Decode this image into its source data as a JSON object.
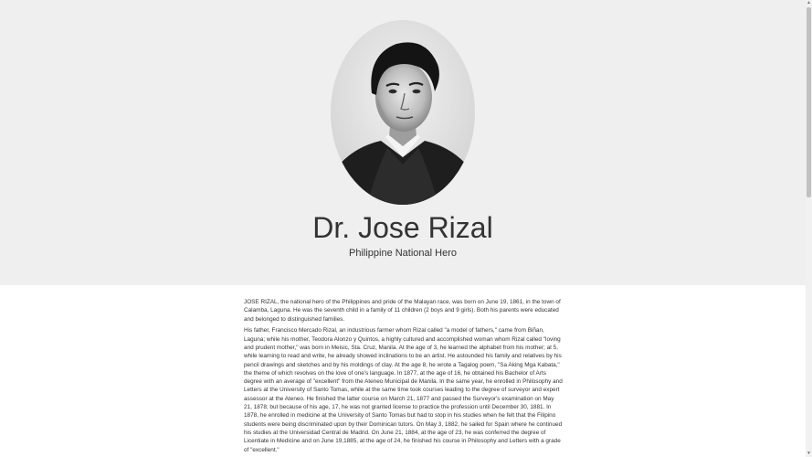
{
  "hero": {
    "name": "Dr. Jose Rizal",
    "tagline": "Philippine National Hero",
    "portrait_icon": "portrait-photo"
  },
  "biography": {
    "paragraphs": [
      "JOSE RIZAL, the national hero of the Philippines and pride of the Malayan race, was born on June 19, 1861, in the town of Calamba, Laguna. He was the seventh child in a family of 11 children (2 boys and 9 girls). Both his parents were educated and belonged to distinguished families.",
      "His father, Francisco Mercado Rizal, an industrious farmer whom Rizal called \"a model of fathers,\" came from Biñan, Laguna; while his mother, Teodora Alonzo y Quintos, a highly cultured and accomplished woman whom Rizal called \"loving and prudent mother,\" was born in Meisic, Sta. Cruz, Manila. At the age of 3, he learned the alphabet from his mother; at 5, while learning to read and write, he already showed inclinations to be an artist. He astounded his family and relatives by his pencil drawings and sketches and by his moldings of clay. At the age 8, he wrote a Tagalog poem, \"Sa Aking Mga Kabata,\" the theme of which revolves on the love of one's language. In 1877, at the age of 16, he obtained his Bachelor of Arts degree with an average of \"excellent\" from the Ateneo Municipal de Manila. In the same year, he enrolled in Philosophy and Letters at the University of Santo Tomas, while at the same time took courses leading to the degree of surveyor and expert assessor at the Ateneo. He finished the latter course on March 21, 1877 and passed the Surveyor's examination on May 21, 1878; but because of his age, 17, he was not granted license to practice the profession until December 30, 1881. In 1878, he enrolled in medicine at the University of Santo Tomas but had to stop in his studies when he felt that the Filipino students were being discriminated upon by their Dominican tutors. On May 3, 1882, he sailed for Spain where he continued his studies at the Universidad Central de Madrid. On June 21, 1884, at the age of 23, he was conferred the degree of Licentiate in Medicine and on June 19,1885, at the age of 24, he finished his course in Philosophy and Letters with a grade of \"excellent.\""
    ]
  },
  "scrollbar": {
    "up_arrow": "▲",
    "down_arrow": "▼",
    "up_icon": "chevron-up-icon",
    "down_icon": "chevron-down-icon"
  },
  "colors": {
    "hero_background": "#efefef",
    "text": "#333333",
    "page_background": "#ffffff"
  }
}
